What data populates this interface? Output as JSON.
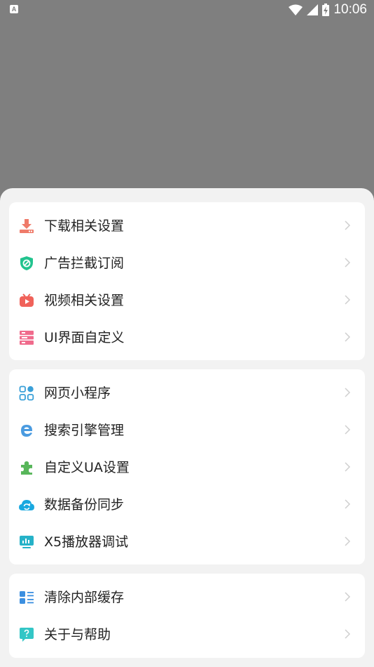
{
  "status_bar": {
    "left_badge": "A",
    "time": "10:06"
  },
  "groups": [
    {
      "items": [
        {
          "label": "下载相关设置",
          "icon": "download-icon",
          "color": "#ef7b6a"
        },
        {
          "label": "广告拦截订阅",
          "icon": "shield-icon",
          "color": "#22c38e"
        },
        {
          "label": "视频相关设置",
          "icon": "video-icon",
          "color": "#f0625a"
        },
        {
          "label": "UI界面自定义",
          "icon": "layout-icon",
          "color": "#f06b8c"
        }
      ]
    },
    {
      "items": [
        {
          "label": "网页小程序",
          "icon": "grid-apps-icon",
          "color": "#3aa0d8"
        },
        {
          "label": "搜索引擎管理",
          "icon": "edge-e-icon",
          "color": "#4a9be0"
        },
        {
          "label": "自定义UA设置",
          "icon": "puzzle-icon",
          "color": "#58b65a"
        },
        {
          "label": "数据备份同步",
          "icon": "cloud-sync-icon",
          "color": "#19a8e0"
        },
        {
          "label": "X5播放器调试",
          "icon": "monitor-chart-icon",
          "color": "#26b2c8"
        }
      ]
    },
    {
      "items": [
        {
          "label": "清除内部缓存",
          "icon": "list-icon",
          "color": "#3c8fe0"
        },
        {
          "label": "关于与帮助",
          "icon": "help-chat-icon",
          "color": "#33c6c6"
        }
      ]
    }
  ]
}
